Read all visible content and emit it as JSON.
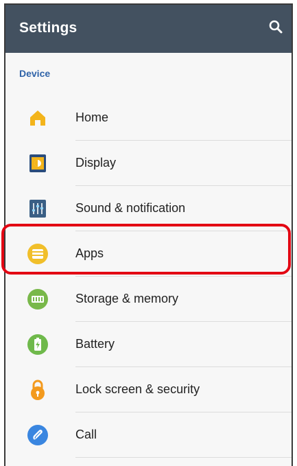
{
  "appbar": {
    "title": "Settings",
    "search_icon": "search-icon"
  },
  "section": {
    "header": "Device"
  },
  "settings_items": [
    {
      "label": "Home",
      "icon": "home-icon",
      "color": "#f3b41b"
    },
    {
      "label": "Display",
      "icon": "display-icon",
      "color": "#2a4c7c"
    },
    {
      "label": "Sound & notification",
      "icon": "sound-icon",
      "color": "#3a5f85"
    },
    {
      "label": "Apps",
      "icon": "apps-icon",
      "color": "#f1bf2a"
    },
    {
      "label": "Storage & memory",
      "icon": "storage-icon",
      "color": "#79b84a"
    },
    {
      "label": "Battery",
      "icon": "battery-icon",
      "color": "#6fb94b"
    },
    {
      "label": "Lock screen & security",
      "icon": "lock-icon",
      "color": "#f39a1e"
    },
    {
      "label": "Call",
      "icon": "call-icon",
      "color": "#3a86e0"
    }
  ],
  "highlight": {
    "item": "Apps",
    "color": "#e30613"
  }
}
